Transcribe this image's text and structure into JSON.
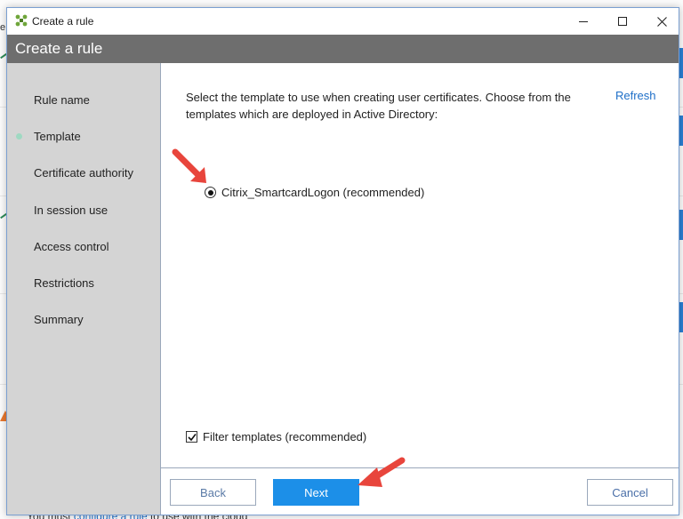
{
  "window": {
    "title": "Create a rule",
    "header": "Create a rule"
  },
  "sidebar": {
    "items": [
      {
        "label": "Rule name",
        "active": false
      },
      {
        "label": "Template",
        "active": true
      },
      {
        "label": "Certificate authority",
        "active": false
      },
      {
        "label": "In session use",
        "active": false
      },
      {
        "label": "Access control",
        "active": false
      },
      {
        "label": "Restrictions",
        "active": false
      },
      {
        "label": "Summary",
        "active": false
      }
    ]
  },
  "content": {
    "instructions": "Select the template to use when creating user certificates. Choose from the templates which are deployed in Active Directory:",
    "refresh_label": "Refresh",
    "templates": [
      {
        "label": "Citrix_SmartcardLogon (recommended)",
        "selected": true
      }
    ],
    "filter_label": "Filter templates (recommended)",
    "filter_checked": true
  },
  "buttons": {
    "back": "Back",
    "next": "Next",
    "cancel": "Cancel"
  },
  "background": {
    "footer_prefix": "You must ",
    "footer_link": "configure a rule",
    "footer_suffix": " to use with the cloud",
    "edge_letter": "e"
  },
  "colors": {
    "accent": "#1c8fe8",
    "header_band": "#6e6e6e",
    "sidebar": "#d4d4d4",
    "link": "#1e6fc8",
    "active_dot": "#9fd9c2",
    "annotation_arrow": "#e8453c"
  },
  "icons": {
    "app": "citrix-cross-icon",
    "minimize": "minimize-icon",
    "maximize": "maximize-icon",
    "close": "close-icon"
  }
}
